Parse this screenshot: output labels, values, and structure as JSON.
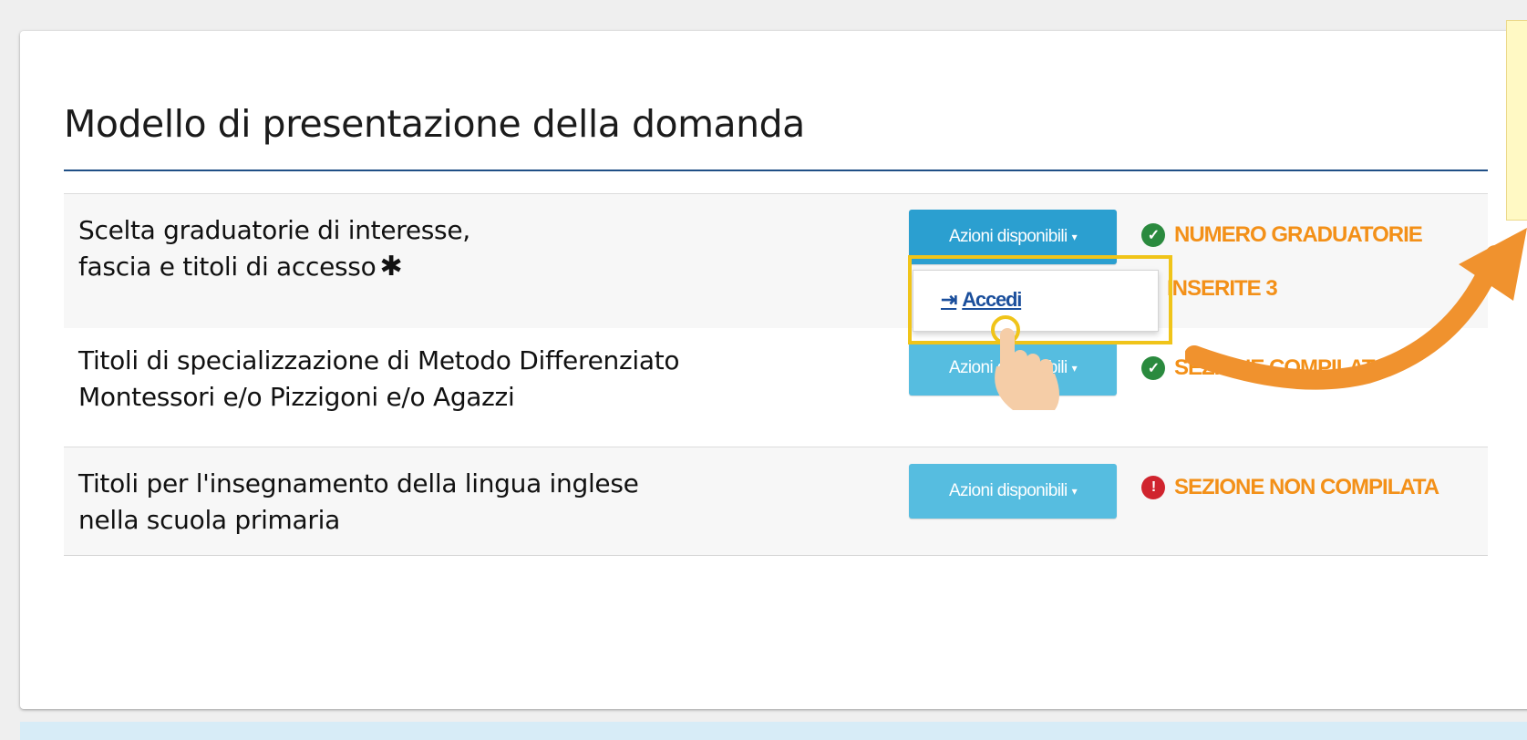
{
  "page": {
    "title": "Modello di presentazione della domanda"
  },
  "rows": [
    {
      "label_line1": "Scelta graduatorie di interesse,",
      "label_line2": "fascia e titoli di accesso",
      "required_marker": "✱",
      "button_label": "Azioni disponibili",
      "status_icon": "check-circle-icon",
      "status_text": "NUMERO GRADUATORIE",
      "status_text_line2": "INSERITE 3"
    },
    {
      "label_line1": "Titoli di specializzazione di Metodo Differenziato",
      "label_line2": "Montessori e/o Pizzigoni e/o Agazzi",
      "button_label": "Azioni disponibili",
      "status_icon": "check-circle-icon",
      "status_text": "SEZIONE COMPILATA"
    },
    {
      "label_line1": "Titoli per l'insegnamento della lingua inglese",
      "label_line2": "nella scuola primaria",
      "button_label": "Azioni disponibili",
      "status_icon": "error-circle-icon",
      "status_text": "SEZIONE NON COMPILATA"
    }
  ],
  "dropdown": {
    "item_label": "Accedi",
    "item_icon": "login-icon"
  },
  "colors": {
    "accent_orange": "#f39018",
    "button_blue": "#56bde0",
    "ok_green": "#2a8a3e",
    "error_red": "#d0242e",
    "rule_blue": "#1f4f86",
    "highlight_yellow": "#f0c419"
  }
}
